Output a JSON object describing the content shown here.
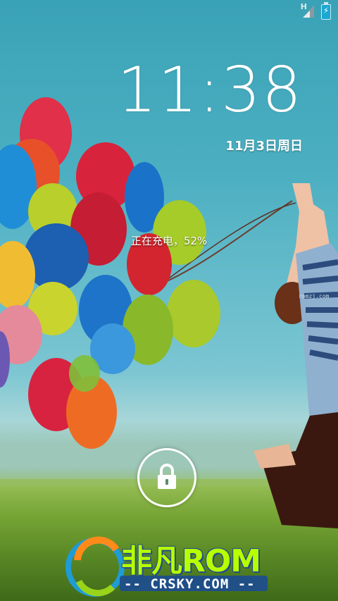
{
  "status_bar": {
    "network_type": "H",
    "signal_icon": "signal-icon",
    "battery_icon": "battery-charging-icon"
  },
  "lockscreen": {
    "time": "11:38",
    "date": "11月3日周日",
    "charging_status": "正在充电，52%",
    "unlock_icon": "lock-icon"
  },
  "watermark": {
    "brand": "非凡ROM",
    "site": "-- CRSKY.COM --",
    "small_mark": "romzj.com"
  },
  "colors": {
    "sky": "#3aa2b6",
    "grass": "#78a737",
    "logo_green": "#b8ff00",
    "logo_blue": "#1f4e8c",
    "text": "#ffffff"
  }
}
